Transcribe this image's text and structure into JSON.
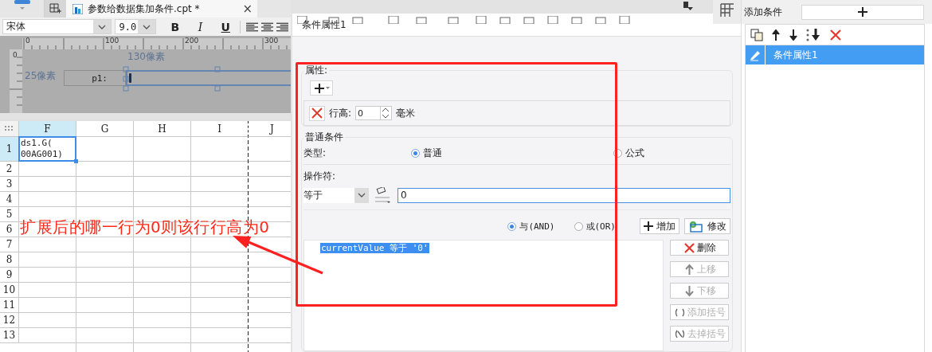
{
  "editor": {
    "tab": {
      "title": "参数给数据集加条件.cpt *",
      "close": "×"
    },
    "toolbar": {
      "font": "宋体",
      "size": "9.0",
      "bold": "B",
      "italic": "I",
      "underline": "U"
    },
    "ruler": {
      "ticks": [
        "0",
        "100",
        "200",
        "300"
      ],
      "side_tick": "0"
    },
    "form": {
      "width_hint": "130像素",
      "height_hint": "25像素",
      "label": "p1:"
    }
  },
  "sheet": {
    "columns": [
      {
        "label": "F",
        "selected": true
      },
      {
        "label": "G",
        "selected": false
      },
      {
        "label": "H",
        "selected": false
      },
      {
        "label": "I",
        "selected": false
      },
      {
        "label": "J",
        "selected": false
      }
    ],
    "rows": [
      {
        "label": "1",
        "selected": true
      },
      {
        "label": "2",
        "selected": false
      },
      {
        "label": "3",
        "selected": false
      },
      {
        "label": "4",
        "selected": false
      },
      {
        "label": "5",
        "selected": false
      },
      {
        "label": "6",
        "selected": false
      },
      {
        "label": "7",
        "selected": false
      },
      {
        "label": "8",
        "selected": false
      },
      {
        "label": "9",
        "selected": false
      },
      {
        "label": "10",
        "selected": false
      },
      {
        "label": "11",
        "selected": false
      },
      {
        "label": "12",
        "selected": false
      },
      {
        "label": "13",
        "selected": false
      }
    ],
    "active_cell": {
      "text": "ds1.G(\n00AG001)"
    },
    "annotation": "扩展后的哪一行为0则该行行高为0"
  },
  "dialog": {
    "title": "条件属性1",
    "properties": {
      "legend": "属性:",
      "items": [
        {
          "label": "行高:",
          "value": "0",
          "unit": "毫米"
        }
      ]
    },
    "condition": {
      "legend": "普通条件",
      "type_label": "类型:",
      "types": [
        {
          "label": "普通",
          "selected": true
        },
        {
          "label": "公式",
          "selected": false
        }
      ],
      "operator_label": "操作符:",
      "operator": "等于",
      "value": "0",
      "joins": [
        {
          "label": "与(AND)",
          "selected": true
        },
        {
          "label": "或(OR)",
          "selected": false
        }
      ],
      "add": "增加",
      "modify": "修改",
      "conditions": [
        {
          "text": "currentValue 等于 '0'",
          "selected": true
        }
      ],
      "side_buttons": [
        {
          "kind": "delete",
          "label": "删除",
          "disabled": false
        },
        {
          "kind": "up",
          "label": "上移",
          "disabled": true
        },
        {
          "kind": "down",
          "label": "下移",
          "disabled": true
        },
        {
          "kind": "add-brackets",
          "label": "添加括号",
          "disabled": true
        },
        {
          "kind": "remove-brackets",
          "label": "去掉括号",
          "disabled": true
        }
      ]
    }
  },
  "side_panel": {
    "add_label": "添加条件",
    "items": [
      {
        "label": "条件属性1",
        "selected": true
      }
    ]
  }
}
